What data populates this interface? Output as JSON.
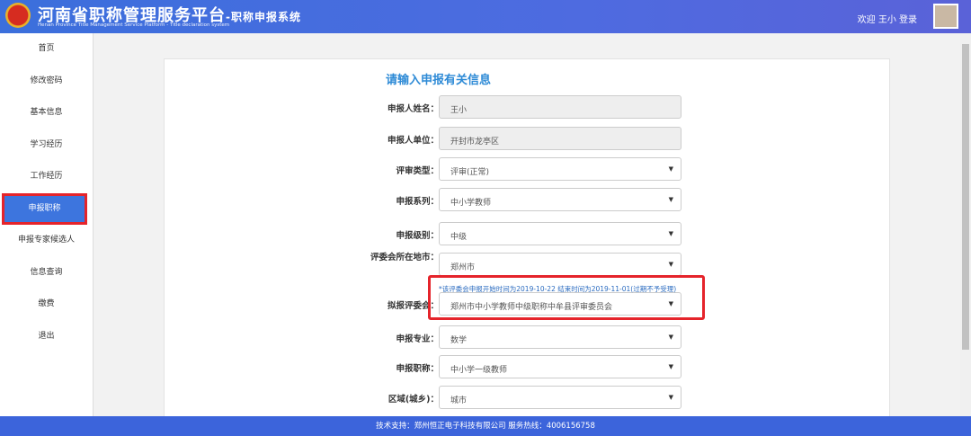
{
  "header": {
    "title": "河南省职称管理服务平台",
    "title_suffix": "-职称申报系统",
    "subtitle": "Henan Province Title Management Service Platform - Title declaration system",
    "user": "欢迎 王小 登录"
  },
  "sidebar": {
    "items": [
      "首页",
      "修改密码",
      "基本信息",
      "学习经历",
      "工作经历",
      "申报职称",
      "申报专家候选人",
      "信息查询",
      "缴费",
      "退出"
    ]
  },
  "form": {
    "title": "请输入申报有关信息",
    "fields": [
      {
        "label": "申报人姓名：",
        "value": "王小"
      },
      {
        "label": "申报人单位：",
        "value": "开封市龙亭区"
      },
      {
        "label": "评审类型：",
        "value": "评审(正常)"
      },
      {
        "label": "申报系列：",
        "value": "中小学教师"
      },
      {
        "label": "申报级别：",
        "value": "中级"
      },
      {
        "label": "评委会所在地市：",
        "value": "郑州市"
      },
      {
        "label": "拟报评委会：",
        "value": "郑州市中小学教师中级职称中牟县评审委员会"
      },
      {
        "label": "申报专业：",
        "value": "数学"
      },
      {
        "label": "申报职称：",
        "value": "中小学一级教师"
      },
      {
        "label": "区域(城乡)：",
        "value": "城市"
      }
    ],
    "note": "*该评委会申报开始时间为2019-10-22 结束时间为2019-11-01(过期不予受理)"
  },
  "footer": {
    "text": "技术支持：郑州恒正电子科技有限公司 服务热线：4006156758"
  }
}
